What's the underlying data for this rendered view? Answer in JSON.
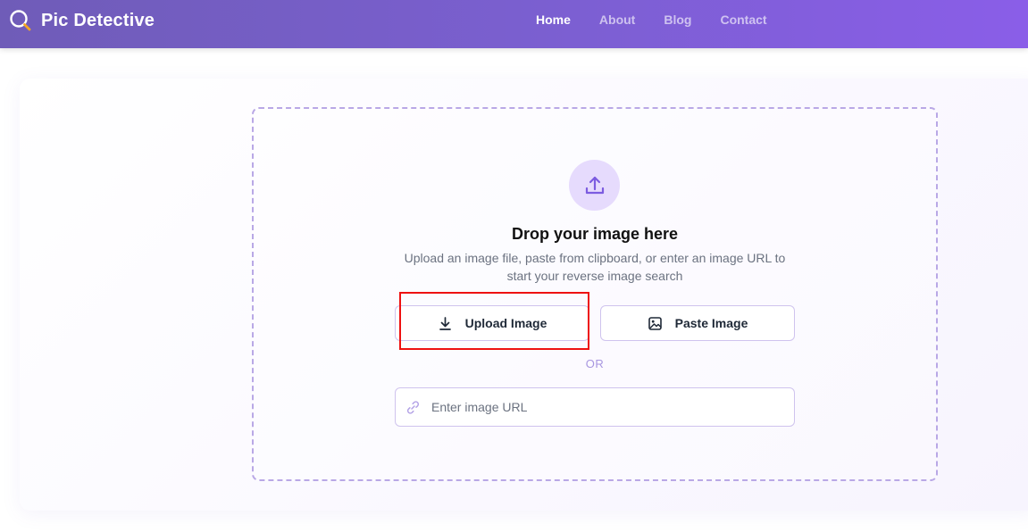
{
  "header": {
    "brand_name": "Pic Detective",
    "brand_icon": "magnifier-icon",
    "nav": [
      {
        "label": "Home",
        "active": true
      },
      {
        "label": "About",
        "active": false
      },
      {
        "label": "Blog",
        "active": false
      },
      {
        "label": "Contact",
        "active": false
      }
    ]
  },
  "dropzone": {
    "icon": "upload-icon",
    "title": "Drop your image here",
    "subtitle": "Upload an image file, paste from clipboard, or enter an image URL to start your reverse image search",
    "upload_button": {
      "label": "Upload Image",
      "icon": "download-icon"
    },
    "paste_button": {
      "label": "Paste Image",
      "icon": "image-icon"
    },
    "or_label": "OR",
    "url_input": {
      "placeholder": "Enter image URL",
      "value": "",
      "icon": "link-icon"
    }
  },
  "colors": {
    "accent": "#8a5ee8",
    "accent_light": "#e6dbfd",
    "highlight": "#ee1111"
  }
}
